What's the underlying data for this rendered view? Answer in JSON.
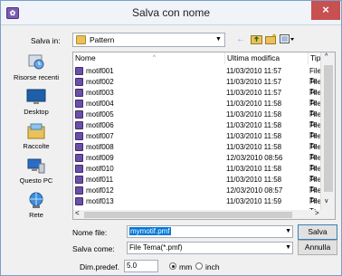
{
  "window": {
    "title": "Salva con nome",
    "app_icon": "image-icon",
    "close": "×"
  },
  "toolbar": {
    "save_in_label": "Salva in:",
    "save_in_value": "Pattern",
    "back": "←",
    "up": "⬚",
    "new_folder": "✱",
    "view": "▦▾"
  },
  "places": [
    {
      "label": "Risorse recenti",
      "icon": "recent-places-icon"
    },
    {
      "label": "Desktop",
      "icon": "desktop-icon"
    },
    {
      "label": "Raccolte",
      "icon": "libraries-icon"
    },
    {
      "label": "Questo PC",
      "icon": "this-pc-icon"
    },
    {
      "label": "Rete",
      "icon": "network-icon"
    }
  ],
  "columns": {
    "name": "Nome",
    "modified": "Ultima modifica",
    "type": "Tipo"
  },
  "files": [
    {
      "name": "motif001",
      "modified": "11/03/2010 11:57",
      "type": "File Te"
    },
    {
      "name": "motif002",
      "modified": "11/03/2010 11:57",
      "type": "File Te"
    },
    {
      "name": "motif003",
      "modified": "11/03/2010 11:57",
      "type": "File Te"
    },
    {
      "name": "motif004",
      "modified": "11/03/2010 11:58",
      "type": "File Te"
    },
    {
      "name": "motif005",
      "modified": "11/03/2010 11:58",
      "type": "File Te"
    },
    {
      "name": "motif006",
      "modified": "11/03/2010 11:58",
      "type": "File Te"
    },
    {
      "name": "motif007",
      "modified": "11/03/2010 11:58",
      "type": "File Te"
    },
    {
      "name": "motif008",
      "modified": "11/03/2010 11:58",
      "type": "File Te"
    },
    {
      "name": "motif009",
      "modified": "12/03/2010 08:56",
      "type": "File Te"
    },
    {
      "name": "motif010",
      "modified": "11/03/2010 11:58",
      "type": "File Te"
    },
    {
      "name": "motif011",
      "modified": "11/03/2010 11:58",
      "type": "File Te"
    },
    {
      "name": "motif012",
      "modified": "12/03/2010 08:57",
      "type": "File Te"
    },
    {
      "name": "motif013",
      "modified": "11/03/2010 11:59",
      "type": "File Te"
    }
  ],
  "form": {
    "filename_label": "Nome file:",
    "filename_value": "mymotif.pmf",
    "savetype_label": "Salva come:",
    "savetype_value": "File Tema(*.pmf)",
    "save_button": "Salva",
    "cancel_button": "Annulla",
    "dim_label": "Dim.predef.",
    "dim_value": "5.0",
    "unit_mm": "mm",
    "unit_inch": "inch",
    "selected_unit": "mm"
  },
  "colors": {
    "accent": "#0078d7",
    "close": "#c75050",
    "file_icon": "#6b4fa8"
  }
}
